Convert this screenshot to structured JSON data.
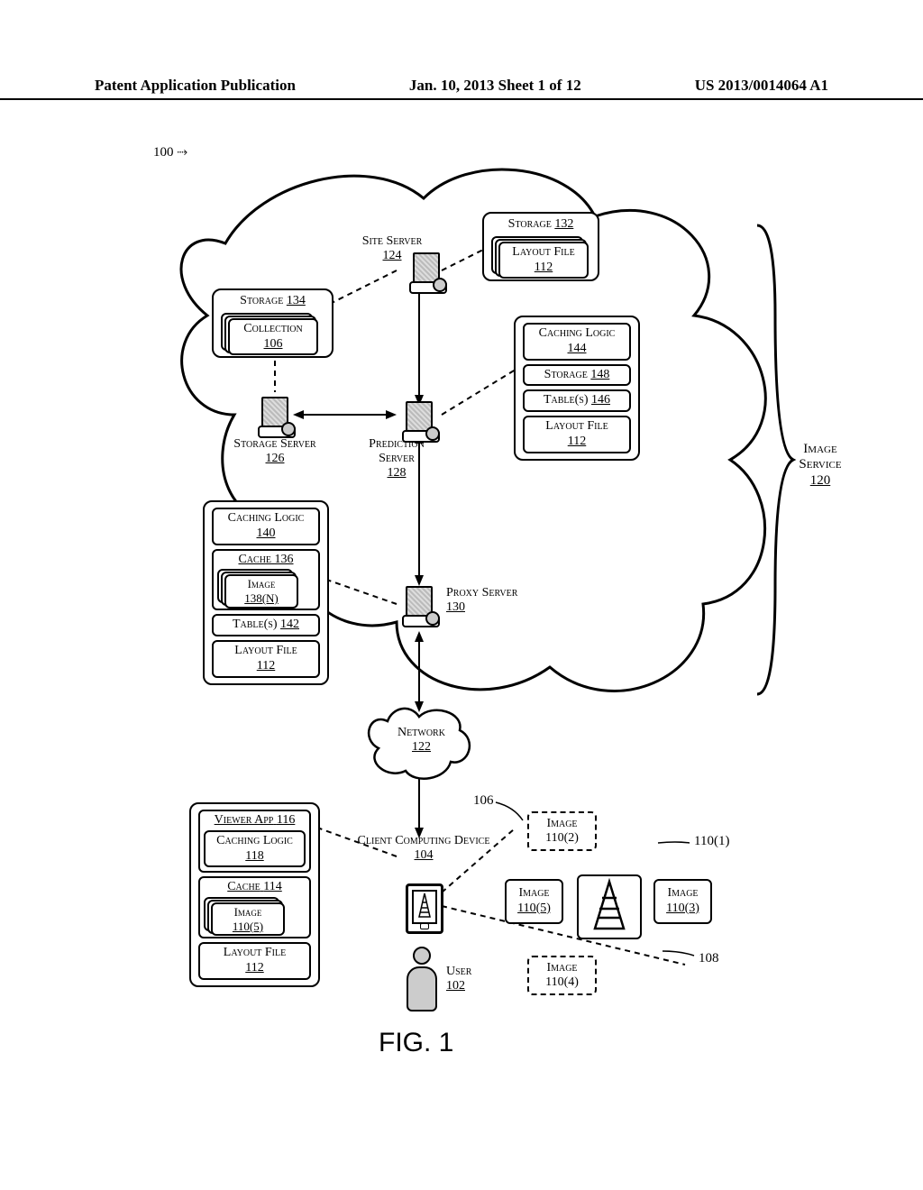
{
  "header": {
    "left": "Patent Application Publication",
    "center": "Jan. 10, 2013  Sheet 1 of 12",
    "right": "US 2013/0014064 A1"
  },
  "refs": {
    "system": "100",
    "user": "102",
    "client_device": "104",
    "collection": "106",
    "viewport": "108",
    "img1": "110(1)",
    "img2": "110(2)",
    "img3": "110(3)",
    "img4": "110(4)",
    "img5": "110(5)",
    "layout_file": "112",
    "cache_client": "114",
    "viewer_app": "116",
    "caching_logic_client": "118",
    "image_service": "120",
    "network": "122",
    "site_server": "124",
    "storage_server": "126",
    "prediction_server": "128",
    "proxy_server": "130",
    "storage_132": "132",
    "storage_134": "134",
    "cache_proxy": "136",
    "image_n": "138(N)",
    "caching_logic_proxy": "140",
    "tables_proxy": "142",
    "caching_logic_pred": "144",
    "tables_pred": "146",
    "storage_pred": "148"
  },
  "labels": {
    "storage": "Storage",
    "layout_file": "Layout File",
    "collection": "Collection",
    "caching_logic": "Caching Logic",
    "tables": "Table(s)",
    "site_server": "Site Server",
    "storage_server": "Storage Server",
    "prediction_server": "Prediction Server",
    "proxy_server": "Proxy Server",
    "image_service": "Image Service",
    "network": "Network",
    "cache": "Cache",
    "image": "Image",
    "viewer_app": "Viewer App",
    "client_device": "Client Computing Device",
    "user": "User"
  },
  "figure_caption": "FIG. 1"
}
